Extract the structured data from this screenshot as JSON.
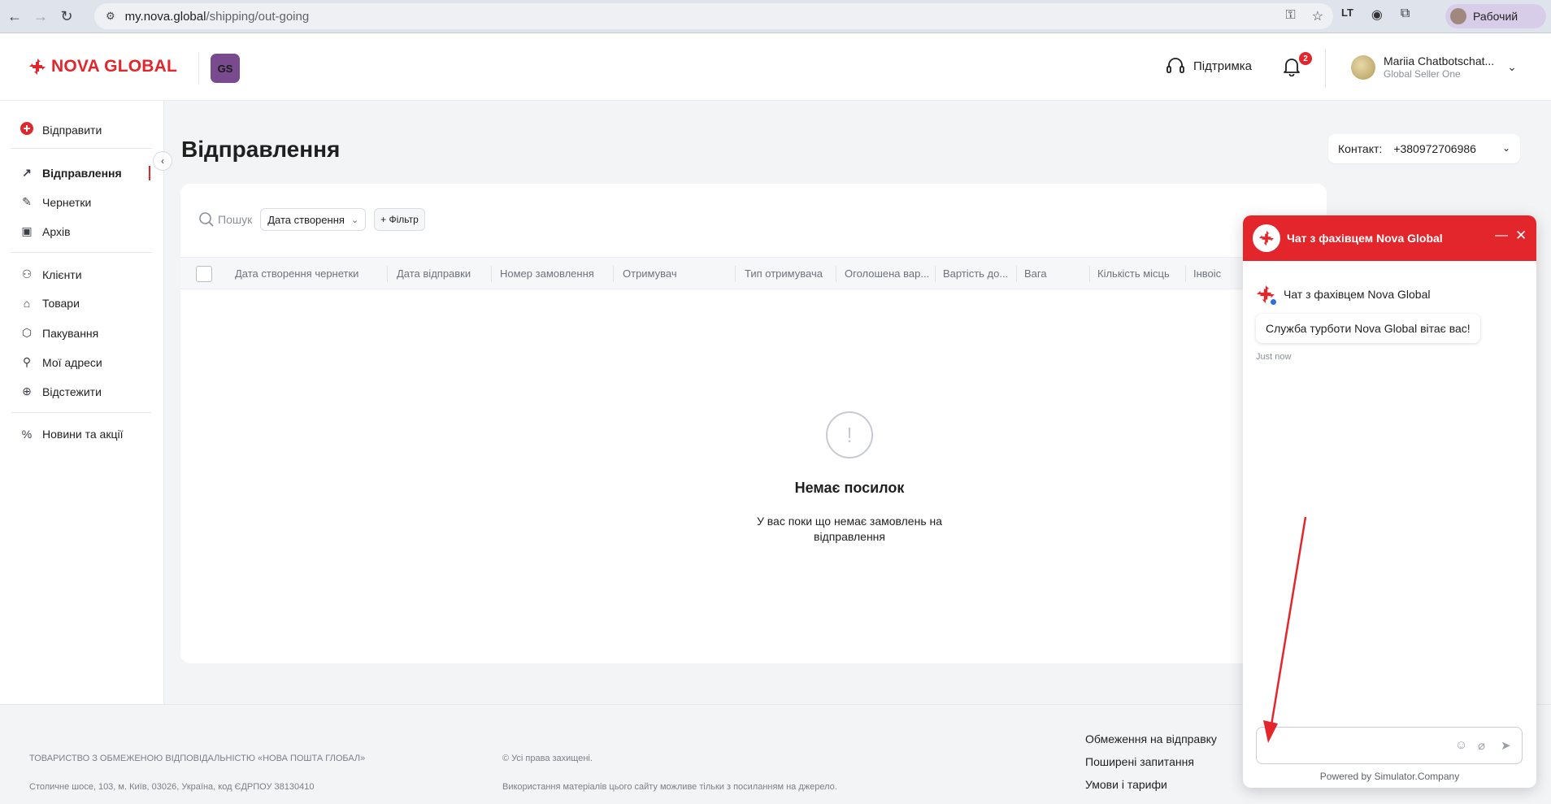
{
  "browser": {
    "url_host": "my.nova.global",
    "url_path": "/shipping/out-going",
    "profile_label": "Рабочий"
  },
  "header": {
    "brand": "NOVA GLOBAL",
    "store_badge": "GS",
    "support_label": "Підтримка",
    "notifications_count": "2",
    "user_name": "Mariia Chatbotschat...",
    "user_role": "Global Seller One"
  },
  "sidebar": {
    "send_label": "Відправити",
    "items": [
      {
        "label": "Відправлення"
      },
      {
        "label": "Чернетки"
      },
      {
        "label": "Архів"
      },
      {
        "label": "Клієнти"
      },
      {
        "label": "Товари"
      },
      {
        "label": "Пакування"
      },
      {
        "label": "Мої адреси"
      },
      {
        "label": "Відстежити"
      },
      {
        "label": "Новини та акції"
      }
    ]
  },
  "main": {
    "title": "Відправлення",
    "contact_label": "Контакт:",
    "contact_value": "+380972706986",
    "search_placeholder": "Пошук",
    "date_filter": "Дата створення",
    "add_filter": "+ Фільтр",
    "columns": [
      "Дата створення чернетки",
      "Дата відправки",
      "Номер замовлення",
      "Отримувач",
      "Тип отримувача",
      "Оголошена вар...",
      "Вартість до...",
      "Вага",
      "Кількість місць",
      "Інвоіс"
    ],
    "empty_title": "Немає посилок",
    "empty_text": "У вас поки що немає замовлень на відправлення"
  },
  "footer": {
    "company": "ТОВАРИСТВО З ОБМЕЖЕНОЮ ВІДПОВІДАЛЬНІСТЮ «НОВА ПОШТА ГЛОБАЛ»",
    "address": "Столичне шосе, 103, м. Київ, 03026, Україна, код ЄДРПОУ 38130410",
    "rights": "© Усі права захищені.",
    "usage": "Використання матеріалів цього сайту можливе тільки з посиланням на джерело.",
    "links": [
      "Обмеження на відправку",
      "Поширені запитання",
      "Умови і тарифи"
    ]
  },
  "chat": {
    "title": "Чат з фахівцем Nova Global",
    "agent_name": "Чат з фахівцем Nova Global",
    "message": "Служба турботи Nova Global вітає вас!",
    "time": "Just now",
    "powered": "Powered by Simulator.Company"
  },
  "colors": {
    "brand_red": "#e3262b",
    "badge_purple": "#7a4a8f",
    "page_bg": "#f3f4f6"
  }
}
